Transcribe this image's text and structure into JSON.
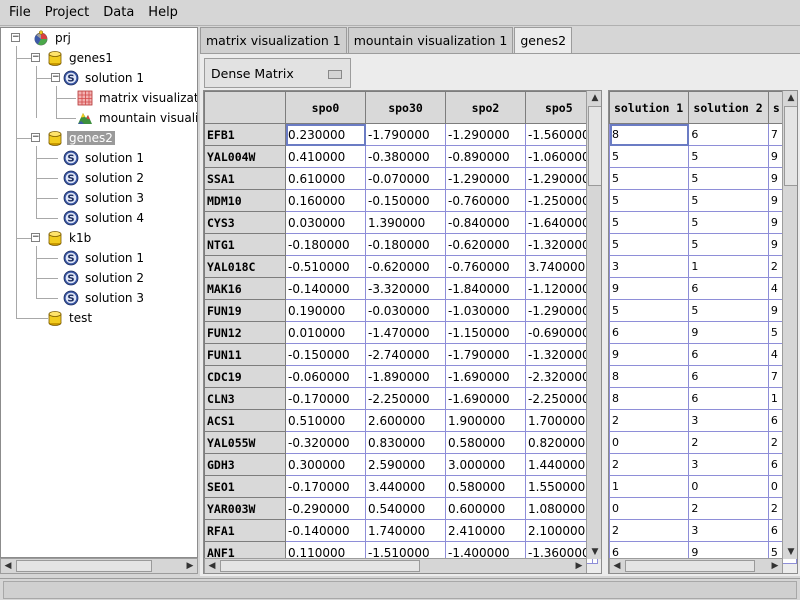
{
  "menu": [
    "File",
    "Project",
    "Data",
    "Help"
  ],
  "tree": {
    "root": "prj",
    "genes1": "genes1",
    "genes1_solution": "solution 1",
    "matrix_vis": "matrix visualization 1",
    "mountain_vis": "mountain visualization 1",
    "genes2": "genes2",
    "genes2_solutions": [
      "solution 1",
      "solution 2",
      "solution 3",
      "solution 4"
    ],
    "k1b": "k1b",
    "k1b_solutions": [
      "solution 1",
      "solution 2",
      "solution 3"
    ],
    "test": "test"
  },
  "tabs": [
    "matrix visualization 1",
    "mountain visualization 1",
    "genes2"
  ],
  "active_tab": 2,
  "matrix_type": "Dense Matrix",
  "data_table": {
    "columns": [
      "spo0",
      "spo30",
      "spo2",
      "spo5"
    ],
    "rows": [
      {
        "gene": "EFB1",
        "values": [
          "0.230000",
          "-1.790000",
          "-1.290000",
          "-1.560000"
        ]
      },
      {
        "gene": "YAL004W",
        "values": [
          "0.410000",
          "-0.380000",
          "-0.890000",
          "-1.060000"
        ]
      },
      {
        "gene": "SSA1",
        "values": [
          "0.610000",
          "-0.070000",
          "-1.290000",
          "-1.290000"
        ]
      },
      {
        "gene": "MDM10",
        "values": [
          "0.160000",
          "-0.150000",
          "-0.760000",
          "-1.250000"
        ]
      },
      {
        "gene": "CYS3",
        "values": [
          "0.030000",
          "1.390000",
          "-0.840000",
          "-1.640000"
        ]
      },
      {
        "gene": "NTG1",
        "values": [
          "-0.180000",
          "-0.180000",
          "-0.620000",
          "-1.320000"
        ]
      },
      {
        "gene": "YAL018C",
        "values": [
          "-0.510000",
          "-0.620000",
          "-0.760000",
          "3.740000"
        ]
      },
      {
        "gene": "MAK16",
        "values": [
          "-0.140000",
          "-3.320000",
          "-1.840000",
          "-1.120000"
        ]
      },
      {
        "gene": "FUN19",
        "values": [
          "0.190000",
          "-0.030000",
          "-1.030000",
          "-1.290000"
        ]
      },
      {
        "gene": "FUN12",
        "values": [
          "0.010000",
          "-1.470000",
          "-1.150000",
          "-0.690000"
        ]
      },
      {
        "gene": "FUN11",
        "values": [
          "-0.150000",
          "-2.740000",
          "-1.790000",
          "-1.320000"
        ]
      },
      {
        "gene": "CDC19",
        "values": [
          "-0.060000",
          "-1.890000",
          "-1.690000",
          "-2.320000"
        ]
      },
      {
        "gene": "CLN3",
        "values": [
          "-0.170000",
          "-2.250000",
          "-1.690000",
          "-2.250000"
        ]
      },
      {
        "gene": "ACS1",
        "values": [
          "0.510000",
          "2.600000",
          "1.900000",
          "1.700000"
        ]
      },
      {
        "gene": "YAL055W",
        "values": [
          "-0.320000",
          "0.830000",
          "0.580000",
          "0.820000"
        ]
      },
      {
        "gene": "GDH3",
        "values": [
          "0.300000",
          "2.590000",
          "3.000000",
          "1.440000"
        ]
      },
      {
        "gene": "SEO1",
        "values": [
          "-0.170000",
          "3.440000",
          "0.580000",
          "1.550000"
        ]
      },
      {
        "gene": "YAR003W",
        "values": [
          "-0.290000",
          "0.540000",
          "0.600000",
          "1.080000"
        ]
      },
      {
        "gene": "RFA1",
        "values": [
          "-0.140000",
          "1.740000",
          "2.410000",
          "2.100000"
        ]
      },
      {
        "gene": "ANF1",
        "values": [
          "0.110000",
          "-1.510000",
          "-1.400000",
          "-1.360000"
        ]
      }
    ]
  },
  "solution_table": {
    "columns": [
      "solution 1",
      "solution 2",
      "s"
    ],
    "rows": [
      [
        "8",
        "6",
        "7"
      ],
      [
        "5",
        "5",
        "9"
      ],
      [
        "5",
        "5",
        "9"
      ],
      [
        "5",
        "5",
        "9"
      ],
      [
        "5",
        "5",
        "9"
      ],
      [
        "5",
        "5",
        "9"
      ],
      [
        "3",
        "1",
        "2"
      ],
      [
        "9",
        "6",
        "4"
      ],
      [
        "5",
        "5",
        "9"
      ],
      [
        "6",
        "9",
        "5"
      ],
      [
        "9",
        "6",
        "4"
      ],
      [
        "8",
        "6",
        "7"
      ],
      [
        "8",
        "6",
        "1"
      ],
      [
        "2",
        "3",
        "6"
      ],
      [
        "0",
        "2",
        "2"
      ],
      [
        "2",
        "3",
        "6"
      ],
      [
        "1",
        "0",
        "0"
      ],
      [
        "0",
        "2",
        "2"
      ],
      [
        "2",
        "3",
        "6"
      ],
      [
        "6",
        "9",
        "5"
      ]
    ]
  },
  "icons": {
    "project": "project-icon",
    "dataset": "dataset-cylinder-icon",
    "solution": "solution-s-icon",
    "matrix": "matrix-vis-icon",
    "mountain": "mountain-vis-icon"
  },
  "colors": {
    "cell_border": "#8e8ed8",
    "focus": "#6b7cc4",
    "selected_tree": "#9a9a9a",
    "dataset_yellow": "#f2cc1f",
    "solution_blue": "#3d5aa8"
  }
}
